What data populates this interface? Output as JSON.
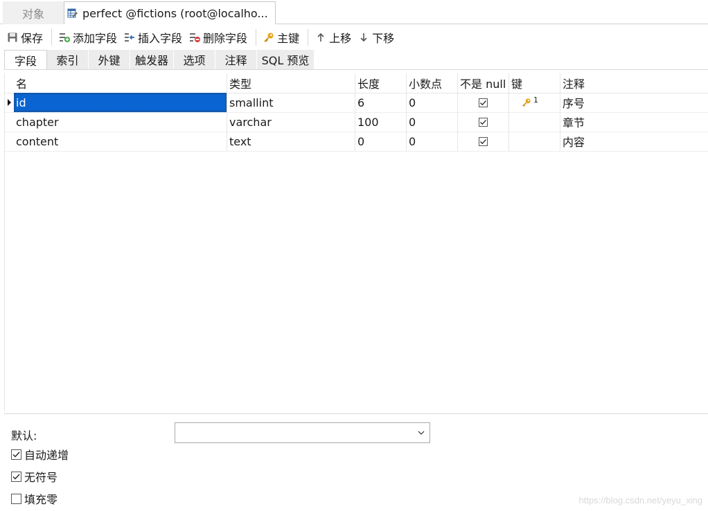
{
  "doc_tabs": {
    "objects": "对象",
    "table": "perfect @fictions (root@localho..."
  },
  "toolbar": {
    "save": "保存",
    "add_field": "添加字段",
    "insert_field": "插入字段",
    "delete_field": "删除字段",
    "primary_key": "主键",
    "move_up": "上移",
    "move_down": "下移"
  },
  "sub_tabs": [
    "字段",
    "索引",
    "外键",
    "触发器",
    "选项",
    "注释",
    "SQL 预览"
  ],
  "grid": {
    "headers": {
      "name": "名",
      "type": "类型",
      "length": "长度",
      "decimals": "小数点",
      "not_null": "不是 null",
      "key": "键",
      "comment": "注释"
    },
    "rows": [
      {
        "name": "id",
        "type": "smallint",
        "length": "6",
        "decimals": "0",
        "not_null": true,
        "key": "1",
        "comment": "序号"
      },
      {
        "name": "chapter",
        "type": "varchar",
        "length": "100",
        "decimals": "0",
        "not_null": true,
        "key": "",
        "comment": "章节"
      },
      {
        "name": "content",
        "type": "text",
        "length": "0",
        "decimals": "0",
        "not_null": true,
        "key": "",
        "comment": "内容"
      }
    ]
  },
  "props": {
    "default_label": "默认:",
    "default_value": "",
    "auto_increment": {
      "label": "自动递增",
      "checked": true
    },
    "unsigned": {
      "label": "无符号",
      "checked": true
    },
    "zerofill": {
      "label": "填充零",
      "checked": false
    }
  },
  "watermark": "https://blog.csdn.net/yeyu_xing",
  "colors": {
    "selection": "#0a64d2",
    "key_icon": "#e8a317"
  }
}
